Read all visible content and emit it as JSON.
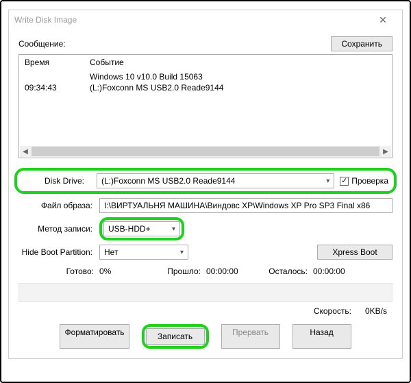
{
  "window": {
    "title": "Write Disk Image",
    "close_glyph": "✕"
  },
  "labels": {
    "message": "Сообщение:",
    "save": "Сохранить",
    "time_header": "Время",
    "event_header": "Событие",
    "disk_drive": "Disk Drive:",
    "verify": "Проверка",
    "image_file": "Файл образа:",
    "write_method": "Метод записи:",
    "hide_boot": "Hide Boot Partition:",
    "xpress_boot": "Xpress Boot",
    "ready": "Готово:",
    "elapsed": "Прошло:",
    "remaining": "Осталось:",
    "speed": "Скорость:"
  },
  "log": {
    "rows": [
      {
        "time": "",
        "event": "Windows 10 v10.0 Build 15063"
      },
      {
        "time": "09:34:43",
        "event": "(L:)Foxconn MS  USB2.0 Reade9144"
      }
    ]
  },
  "fields": {
    "disk_drive_value": "(L:)Foxconn MS  USB2.0 Reade9144",
    "verify_checked": "✓",
    "image_file_value": "I:\\ВИРТУАЛЬНЯ МАШИНА\\Виндовс ХР\\Windows XP Pro SP3 Final x86",
    "write_method_value": "USB-HDD+",
    "hide_boot_value": "Нет"
  },
  "progress": {
    "percent": "0%",
    "elapsed_value": "00:00:00",
    "remaining_value": "00:00:00",
    "speed_value": "0KB/s"
  },
  "buttons": {
    "format": "Форматировать",
    "write": "Записать",
    "abort": "Прервать",
    "back": "Назад"
  },
  "glyphs": {
    "left": "◀",
    "right": "▶",
    "down": "▾"
  }
}
